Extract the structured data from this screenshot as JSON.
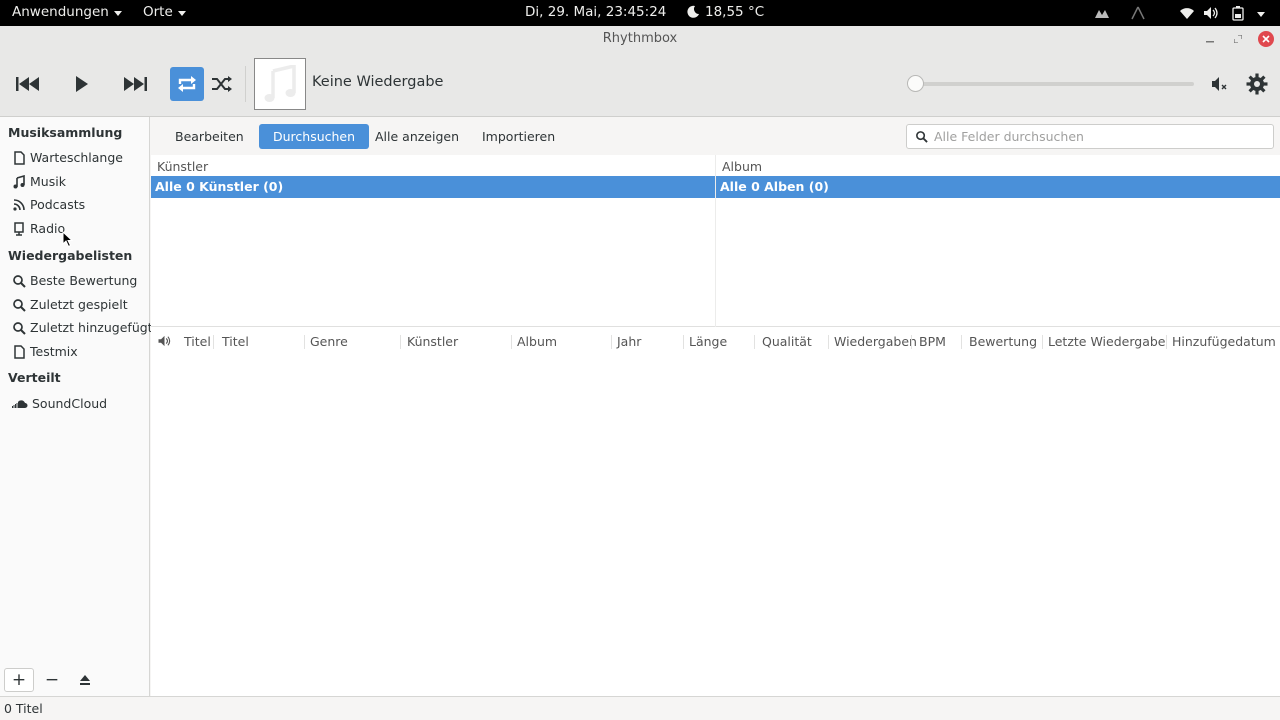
{
  "topbar": {
    "apps_label": "Anwendungen",
    "places_label": "Orte",
    "clock": "Di, 29. Mai, 23:45:24",
    "weather": "18,55 °C",
    "icons": [
      "moon-icon",
      "dock-icon",
      "accessibility-icon",
      "wifi-icon",
      "volume-icon",
      "battery-icon",
      "system-menu-caret"
    ]
  },
  "window": {
    "title": "Rhythmbox"
  },
  "toolbar": {
    "now_playing": "Keine Wiedergabe"
  },
  "sidebar": {
    "sections": [
      {
        "title": "Musiksammlung",
        "items": [
          {
            "label": "Warteschlange",
            "icon": "document-icon"
          },
          {
            "label": "Musik",
            "icon": "music-note-icon"
          },
          {
            "label": "Podcasts",
            "icon": "rss-icon"
          },
          {
            "label": "Radio",
            "icon": "radio-icon"
          }
        ]
      },
      {
        "title": "Wiedergabelisten",
        "items": [
          {
            "label": "Beste Bewertung",
            "icon": "search-icon"
          },
          {
            "label": "Zuletzt gespielt",
            "icon": "search-icon"
          },
          {
            "label": "Zuletzt hinzugefügt",
            "icon": "search-icon"
          },
          {
            "label": "Testmix",
            "icon": "document-icon"
          }
        ]
      },
      {
        "title": "Verteilt",
        "items": [
          {
            "label": "SoundCloud",
            "icon": "soundcloud-icon"
          }
        ]
      }
    ],
    "bottom_buttons": {
      "add": "+",
      "remove": "−"
    }
  },
  "subbar": {
    "buttons": [
      "Bearbeiten",
      "Durchsuchen",
      "Alle anzeigen",
      "Importieren"
    ],
    "active": "Durchsuchen",
    "search_placeholder": "Alle Felder durchsuchen"
  },
  "browser": {
    "artist_header": "Künstler",
    "album_header": "Album",
    "artist_selected": "Alle 0 Künstler (0)",
    "album_selected": "Alle 0 Alben (0)"
  },
  "tracklist": {
    "columns": [
      "Titel",
      "Titel",
      "Genre",
      "Künstler",
      "Album",
      "Jahr",
      "Länge",
      "Qualität",
      "Wiedergaben",
      "BPM",
      "Bewertung",
      "Letzte Wiedergabe",
      "Hinzufügedatum"
    ]
  },
  "status": {
    "text": "0 Titel"
  },
  "colors": {
    "accent": "#4a90d9",
    "close": "#e0484e",
    "topbar": "#000000"
  }
}
